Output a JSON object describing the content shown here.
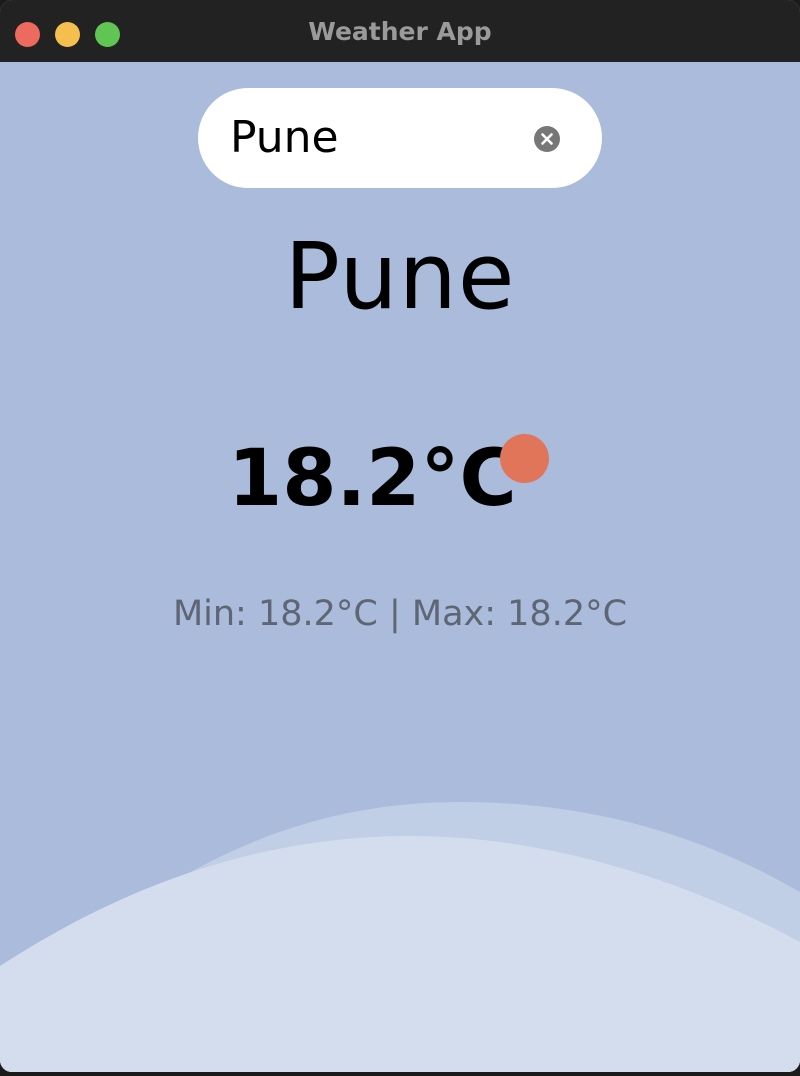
{
  "window": {
    "title": "Weather App"
  },
  "search": {
    "value": "Pune",
    "placeholder": ""
  },
  "weather": {
    "city": "Pune",
    "temperature": "18.2°C",
    "minmax": "Min: 18.2°C | Max: 18.2°C",
    "icon": "sun-icon"
  },
  "colors": {
    "background": "#aabbdc",
    "wave_back": "#c0cee6",
    "wave_front": "#d4ddee",
    "sun": "#e0755a",
    "secondary_text": "#5f6673"
  }
}
